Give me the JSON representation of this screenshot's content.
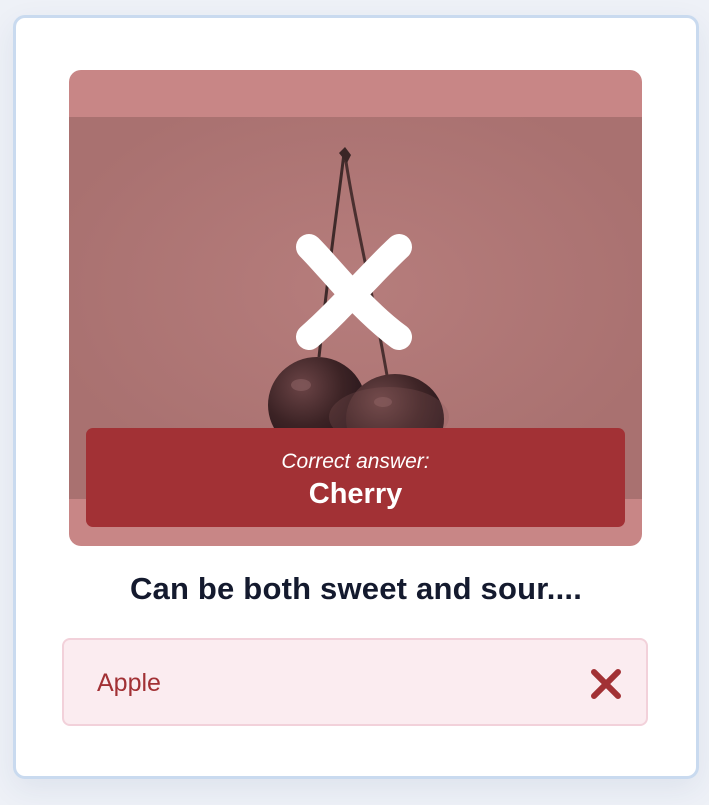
{
  "feedback": {
    "correct_answer_label": "Correct answer:",
    "correct_answer_value": "Cherry",
    "result_icon": "wrong-x-icon"
  },
  "question": {
    "text": "Can be both sweet and sour...."
  },
  "options": [
    {
      "label": "Apple",
      "state": "incorrect",
      "icon": "x-icon"
    }
  ],
  "colors": {
    "overlay_red": "#c88686",
    "answer_box": "#a23135",
    "option_border": "#f2d1da",
    "option_background": "#fbecf0",
    "wrong_text": "#a23135",
    "question_text": "#141a2e"
  }
}
